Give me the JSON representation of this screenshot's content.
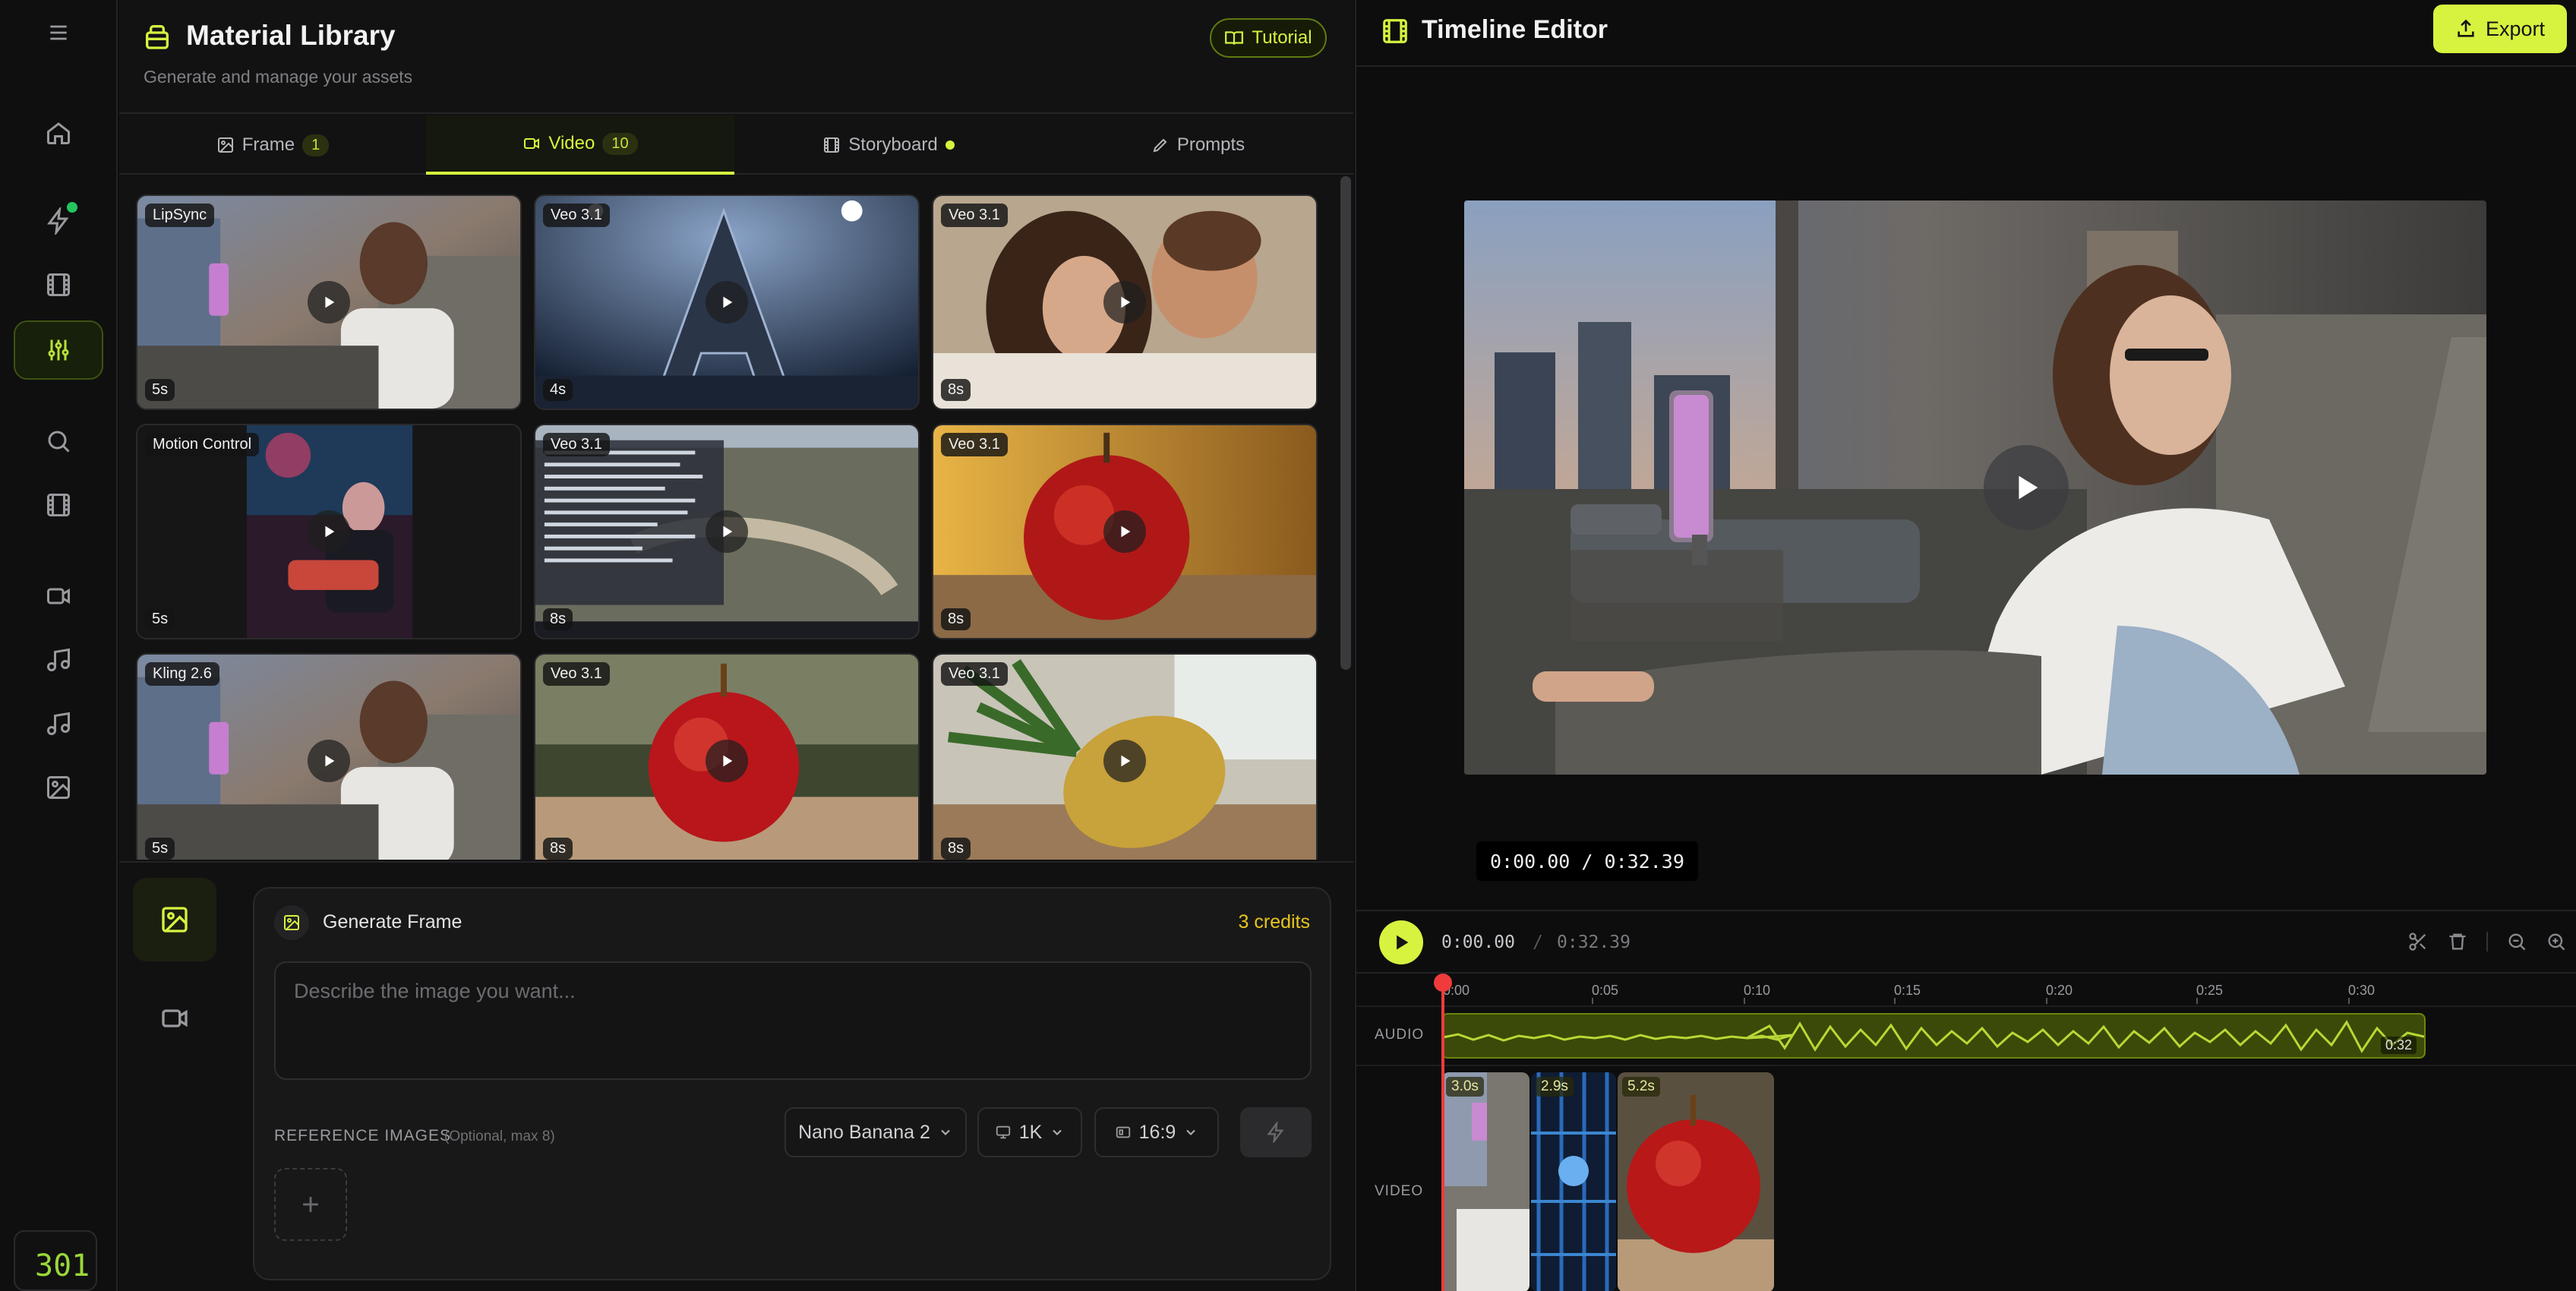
{
  "sidebar": {
    "items": [
      {
        "name": "menu-icon"
      },
      {
        "name": "home-icon"
      },
      {
        "name": "lightning-icon"
      },
      {
        "name": "film-icon"
      },
      {
        "name": "sliders-icon"
      },
      {
        "name": "search-icon"
      },
      {
        "name": "film-strip-icon"
      },
      {
        "name": "video-icon"
      },
      {
        "name": "music-icon"
      },
      {
        "name": "music-note-icon"
      },
      {
        "name": "image-icon"
      }
    ],
    "credit_balance": "301"
  },
  "library": {
    "title": "Material Library",
    "subtitle": "Generate and manage your assets",
    "tutorial_label": "Tutorial",
    "tabs": [
      {
        "label": "Frame",
        "count": "1"
      },
      {
        "label": "Video",
        "count": "10"
      },
      {
        "label": "Storyboard"
      },
      {
        "label": "Prompts"
      }
    ],
    "cards": [
      {
        "badge": "LipSync",
        "duration": "5s"
      },
      {
        "badge": "Veo 3.1",
        "duration": "4s"
      },
      {
        "badge": "Veo 3.1",
        "duration": "8s"
      },
      {
        "badge": "Motion Control",
        "duration": "5s"
      },
      {
        "badge": "Veo 3.1",
        "duration": "8s"
      },
      {
        "badge": "Veo 3.1",
        "duration": "8s"
      },
      {
        "badge": "Kling 2.6",
        "duration": "5s"
      },
      {
        "badge": "Veo 3.1",
        "duration": "8s"
      },
      {
        "badge": "Veo 3.1",
        "duration": "8s"
      }
    ]
  },
  "generate": {
    "title": "Generate Frame",
    "credits": "3 credits",
    "placeholder": "Describe the image you want...",
    "reference_label": "REFERENCE IMAGES",
    "reference_hint": "(Optional, max 8)",
    "model": "Nano Banana 2",
    "resolution": "1K",
    "aspect": "16:9"
  },
  "editor": {
    "title": "Timeline Editor",
    "export_label": "Export",
    "timecode": "0:00.00 / 0:32.39",
    "current_time": "0:00.00",
    "separator": "/",
    "total_time": "0:32.39",
    "ruler": [
      "0:00",
      "0:05",
      "0:10",
      "0:15",
      "0:20",
      "0:25",
      "0:30"
    ],
    "audio_label": "AUDIO",
    "video_label": "VIDEO",
    "audio_duration": "0:32",
    "clips": [
      {
        "duration": "3.0s"
      },
      {
        "duration": "2.9s"
      },
      {
        "duration": "5.2s"
      }
    ]
  },
  "colors": {
    "accent": "#d7f23f",
    "background": "#0d0d0e",
    "panel": "#121213",
    "credits": "#e8c51e",
    "playhead": "#ef3b3b"
  }
}
